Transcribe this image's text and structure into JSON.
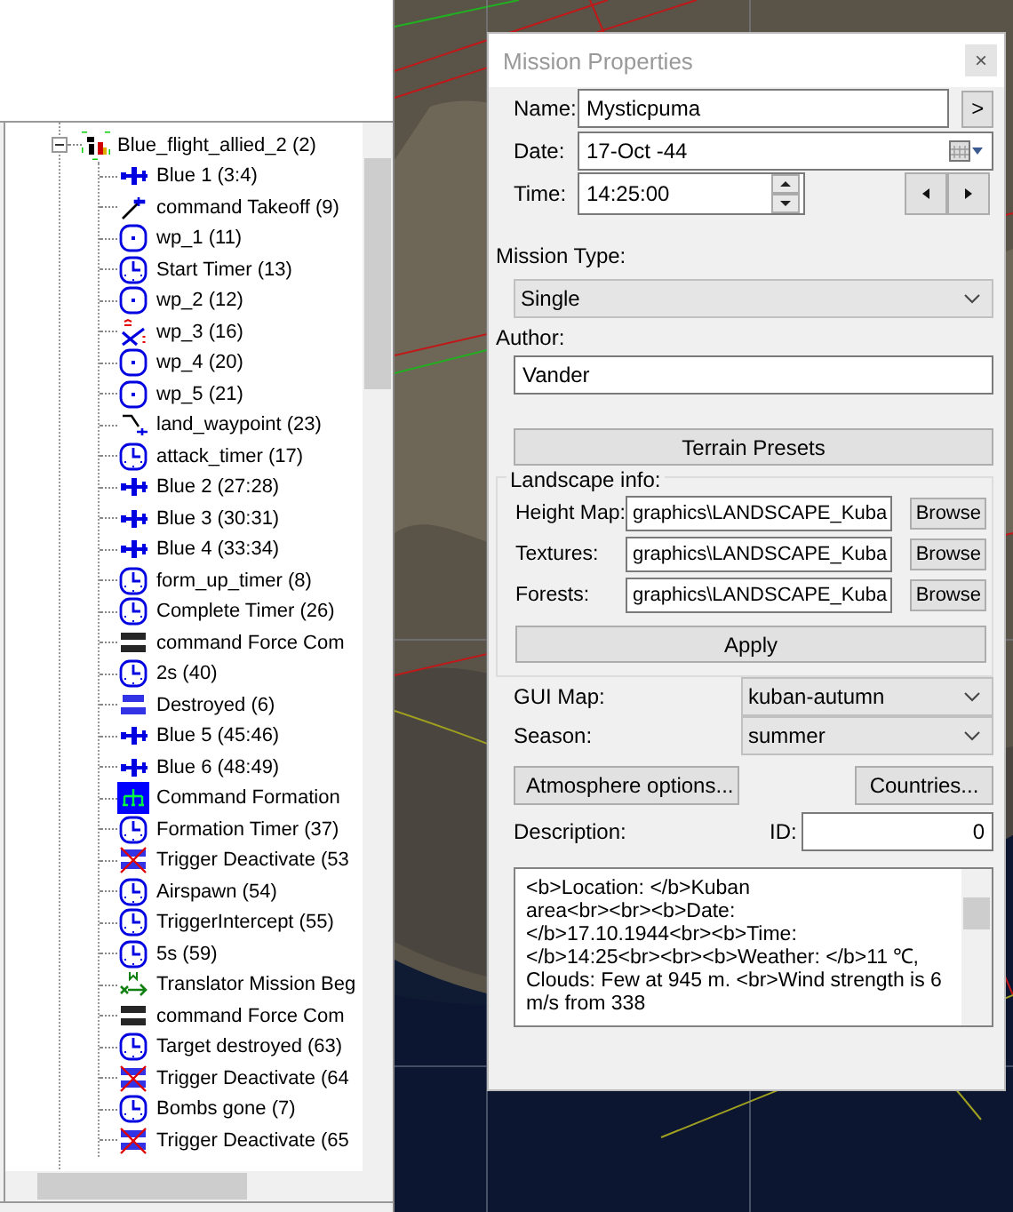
{
  "tree": {
    "root": {
      "label": "Blue_flight_allied_2 (2)",
      "kind": "group",
      "expanded": true,
      "selected": false,
      "children": [
        {
          "label": "Blue 1 (3:4)",
          "kind": "plane",
          "selected": false
        },
        {
          "label": "command Takeoff (9)",
          "kind": "takeoff",
          "selected": false
        },
        {
          "label": "wp_1 (11)",
          "kind": "waypoint",
          "selected": false
        },
        {
          "label": "Start Timer (13)",
          "kind": "timer",
          "selected": false
        },
        {
          "label": "wp_2 (12)",
          "kind": "waypoint",
          "selected": false
        },
        {
          "label": "wp_3 (16)",
          "kind": "attack",
          "selected": false
        },
        {
          "label": "wp_4 (20)",
          "kind": "waypoint",
          "selected": false
        },
        {
          "label": "wp_5 (21)",
          "kind": "waypoint",
          "selected": false
        },
        {
          "label": "land_waypoint (23)",
          "kind": "land",
          "selected": false
        },
        {
          "label": "attack_timer (17)",
          "kind": "timer",
          "selected": false
        },
        {
          "label": "Blue 2 (27:28)",
          "kind": "plane",
          "selected": false
        },
        {
          "label": "Blue 3 (30:31)",
          "kind": "plane",
          "selected": false
        },
        {
          "label": "Blue 4 (33:34)",
          "kind": "plane",
          "selected": false
        },
        {
          "label": "form_up_timer (8)",
          "kind": "timer",
          "selected": false
        },
        {
          "label": "Complete Timer (26)",
          "kind": "timer",
          "selected": false
        },
        {
          "label": "command Force Com",
          "kind": "complete",
          "selected": false
        },
        {
          "label": "2s (40)",
          "kind": "timer",
          "selected": false
        },
        {
          "label": "Destroyed (6)",
          "kind": "goal",
          "selected": false
        },
        {
          "label": "Blue 5 (45:46)",
          "kind": "plane",
          "selected": false
        },
        {
          "label": "Blue 6 (48:49)",
          "kind": "plane",
          "selected": false
        },
        {
          "label": "Command Formation",
          "kind": "formation",
          "selected": true
        },
        {
          "label": "Formation Timer (37)",
          "kind": "timer",
          "selected": false
        },
        {
          "label": "Trigger Deactivate (53",
          "kind": "deactivate",
          "selected": false
        },
        {
          "label": "Airspawn (54)",
          "kind": "timer",
          "selected": false
        },
        {
          "label": "TriggerIntercept (55)",
          "kind": "timer",
          "selected": false
        },
        {
          "label": "5s (59)",
          "kind": "timer",
          "selected": false
        },
        {
          "label": "Translator Mission Beg",
          "kind": "translator",
          "selected": false
        },
        {
          "label": "command Force Com",
          "kind": "complete",
          "selected": false
        },
        {
          "label": "Target destroyed (63)",
          "kind": "timer",
          "selected": false
        },
        {
          "label": "Trigger Deactivate (64",
          "kind": "deactivate",
          "selected": false
        },
        {
          "label": "Bombs gone (7)",
          "kind": "timer",
          "selected": false
        },
        {
          "label": "Trigger Deactivate (65",
          "kind": "deactivate",
          "selected": false
        }
      ]
    }
  },
  "dialog": {
    "title": "Mission Properties",
    "close": "×",
    "name_label": "Name:",
    "name": "Mysticpuma",
    "name_button": ">",
    "date_label": "Date:",
    "date": "17-Oct -44",
    "time_label": "Time:",
    "time": "14:25:00",
    "mission_type_label": "Mission Type:",
    "mission_type": "Single",
    "author_label": "Author:",
    "author": "Vander",
    "terrain_presets": "Terrain Presets",
    "landscape": {
      "legend": "Landscape info:",
      "rows": [
        {
          "label": "Height Map:",
          "value": "graphics\\LANDSCAPE_Kuba",
          "button": "Browse"
        },
        {
          "label": "Textures:",
          "value": "graphics\\LANDSCAPE_Kuba",
          "button": "Browse"
        },
        {
          "label": "Forests:",
          "value": "graphics\\LANDSCAPE_Kuba",
          "button": "Browse"
        }
      ],
      "apply": "Apply"
    },
    "gui_map_label": "GUI Map:",
    "gui_map": "kuban-autumn",
    "season_label": "Season:",
    "season": "summer",
    "atmosphere": "Atmosphere options...",
    "countries": "Countries...",
    "description_label": "Description:",
    "id_label": "ID:",
    "id": "0",
    "description": "<b>Location: </b>Kuban\narea<br><br><b>Date:\n</b>17.10.1944<br><b>Time:\n</b>14:25<br><br><b>Weather: </b>11 ℃,\nClouds: Few at 945 m. <br>Wind strength is 6\nm/s from 338"
  }
}
